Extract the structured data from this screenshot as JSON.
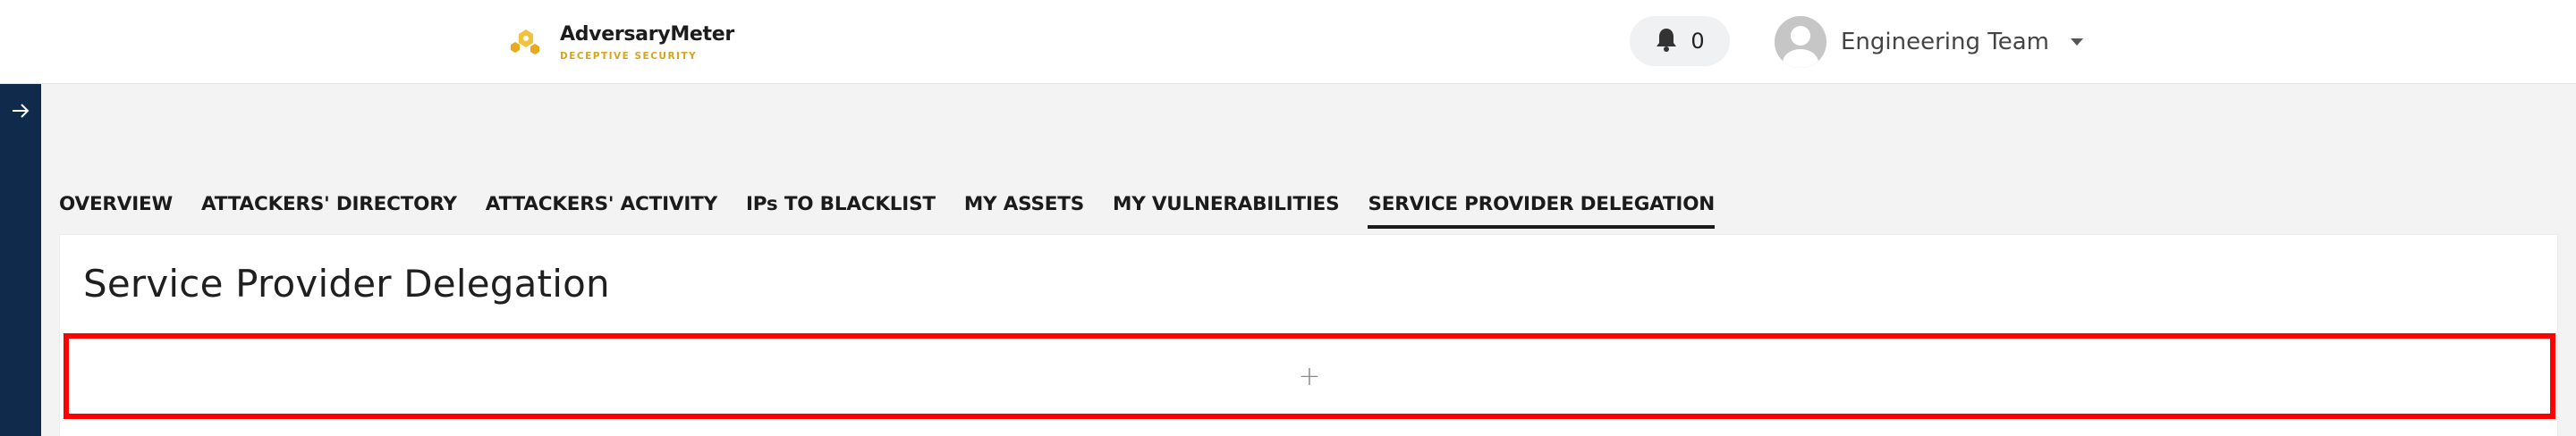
{
  "header": {
    "brand_name": "AdversaryMeter",
    "brand_tagline": "DECEPTIVE SECURITY",
    "notifications_count": "0",
    "user_name": "Engineering Team"
  },
  "tabs": [
    {
      "label": "OVERVIEW",
      "active": false
    },
    {
      "label": "ATTACKERS' DIRECTORY",
      "active": false
    },
    {
      "label": "ATTACKERS' ACTIVITY",
      "active": false
    },
    {
      "label": "IPs TO BLACKLIST",
      "active": false
    },
    {
      "label": "MY ASSETS",
      "active": false
    },
    {
      "label": "MY VULNERABILITIES",
      "active": false
    },
    {
      "label": "SERVICE PROVIDER DELEGATION",
      "active": true
    }
  ],
  "main": {
    "page_title": "Service Provider Delegation",
    "add_symbol": "+"
  },
  "colors": {
    "sidebar": "#0f2a4b",
    "brand_accent": "#d9a21b",
    "highlight_border": "#ff0000"
  }
}
